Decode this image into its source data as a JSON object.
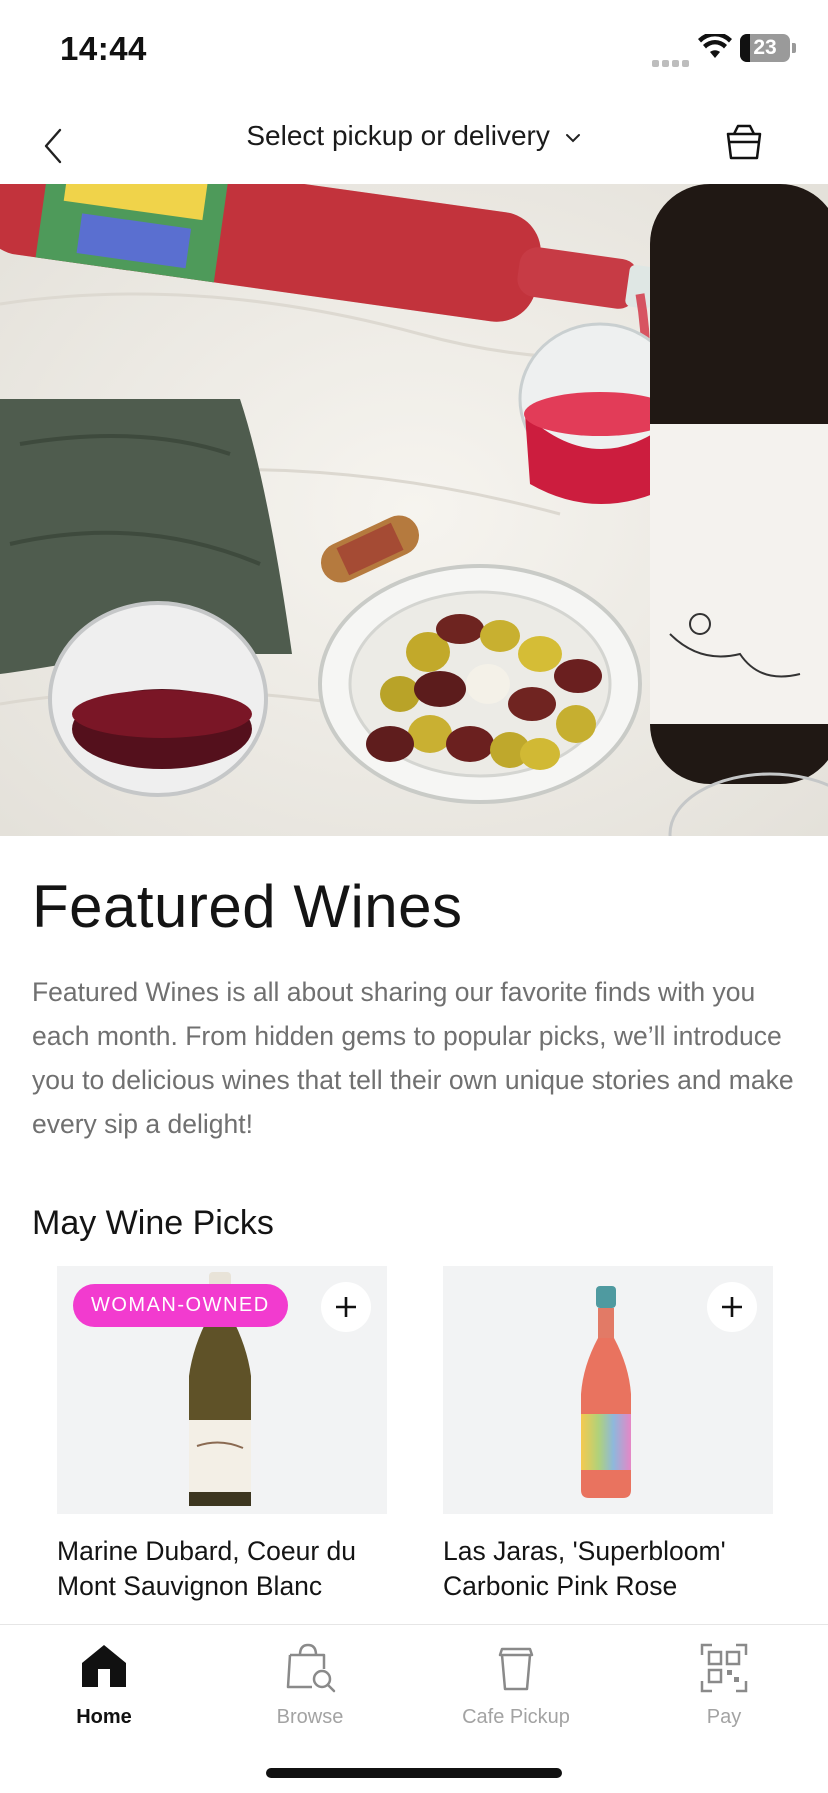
{
  "status_bar": {
    "time": "14:44",
    "battery": "23"
  },
  "header": {
    "title": "Select pickup or delivery"
  },
  "hero": {},
  "main": {
    "heading": "Featured Wines",
    "description": "Featured Wines is all about sharing our favorite finds with you each month. From hidden gems to popular picks, we’ll introduce you to delicious wines that tell their own unique stories and make every sip a delight!",
    "section_title": "May Wine Picks",
    "products": [
      {
        "badge": "WOMAN-OWNED",
        "title": "Marine Dubard, Coeur du Mont Sauvignon Blanc"
      },
      {
        "title": "Las Jaras, 'Superbloom' Carbonic Pink Rose"
      }
    ]
  },
  "tabbar": {
    "items": [
      {
        "label": "Home",
        "icon": "home-icon",
        "active": true
      },
      {
        "label": "Browse",
        "icon": "bag-search-icon"
      },
      {
        "label": "Cafe Pickup",
        "icon": "coffee-cup-icon"
      },
      {
        "label": "Pay",
        "icon": "qr-code-icon"
      }
    ]
  },
  "colors": {
    "badge": "#f23bcf",
    "muted_text": "#707070",
    "inactive_tab": "#a3a3a3"
  }
}
